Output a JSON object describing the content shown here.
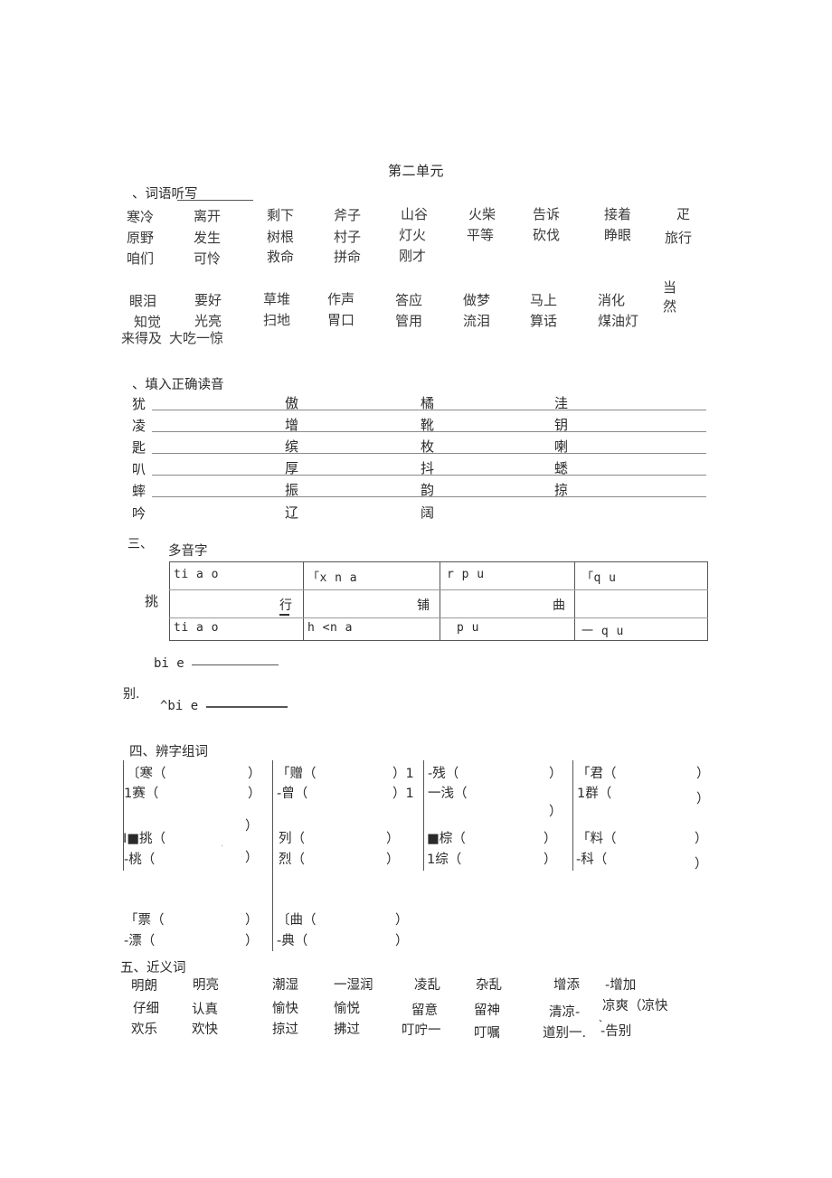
{
  "document": {
    "title": "第二单元"
  },
  "section1": {
    "heading": "、词语听写",
    "rows": [
      [
        "寒冷",
        "离开",
        "剩下",
        "斧子",
        "山谷",
        "火柴",
        "告诉",
        "接着",
        "疋"
      ],
      [
        "原野",
        "发生",
        "树根",
        "村子",
        "灯火",
        "平等",
        "砍伐",
        "睁眼",
        "旅行"
      ],
      [
        "咱们",
        "可怜",
        "救命",
        "拼命",
        "刚才",
        "",
        "",
        "",
        ""
      ],
      [
        "眼泪",
        "要好",
        "草堆",
        "作声",
        "答应",
        "做梦",
        "马上",
        "消化",
        "当然"
      ],
      [
        "知觉",
        "光亮",
        "扫地",
        "胃口",
        "管用",
        "流泪",
        "算话",
        "煤油灯",
        ""
      ],
      [
        "来得及",
        "大吃一惊",
        "",
        "",
        "",
        "",
        "",
        "",
        ""
      ]
    ]
  },
  "section2": {
    "heading": "、填入正确读音",
    "rows": [
      {
        "lead": "犹",
        "chars": [
          "傲",
          "橘",
          "洼"
        ]
      },
      {
        "lead": "凌",
        "chars": [
          "增",
          "靴",
          "钥"
        ]
      },
      {
        "lead": "匙",
        "chars": [
          "缤",
          "枚",
          "喇"
        ]
      },
      {
        "lead": "叭",
        "chars": [
          "厚",
          "抖",
          "蟋"
        ]
      },
      {
        "lead": "蟀",
        "chars": [
          "振",
          "韵",
          "掠"
        ]
      },
      {
        "lead": "吟",
        "chars": [
          "辽",
          "阔",
          ""
        ]
      }
    ]
  },
  "section3": {
    "number": "三、",
    "heading": "多音字",
    "left_char": "挑",
    "columns": [
      {
        "top_pinyin": "ti a o",
        "char": "行",
        "bottom_pinyin": "ti a o"
      },
      {
        "top_pinyin": "「x n a",
        "char": "铺",
        "bottom_pinyin": "h <n a"
      },
      {
        "top_pinyin": "r p u",
        "char": "曲",
        "bottom_pinyin": "p u"
      },
      {
        "top_pinyin": "「q u",
        "char": "",
        "bottom_pinyin": "一 q u"
      }
    ],
    "bie_block": {
      "line1": "bi e",
      "middle": "别.",
      "line2": "^bi e"
    }
  },
  "section4": {
    "heading": "四、辨字组词",
    "groups": [
      {
        "prefix1": "〔",
        "char1": "寒",
        "prefix2": "1",
        "char2": "赛",
        "suffix1": "",
        "suffix2": ""
      },
      {
        "prefix1": "「",
        "char1": "赠",
        "prefix2": "-",
        "char2": "曾",
        "suffix1": "1",
        "suffix2": "1"
      },
      {
        "prefix1": "-",
        "char1": "残",
        "prefix2": "一",
        "char2": "浅",
        "suffix1": "",
        "suffix2": ""
      },
      {
        "prefix1": "「",
        "char1": "君",
        "prefix2": "1",
        "char2": "群",
        "suffix1": "",
        "suffix2": ""
      },
      {
        "prefix1": "I■",
        "char1": "挑",
        "prefix2": "-",
        "char2": "桃",
        "suffix1": "",
        "suffix2": ""
      },
      {
        "prefix1": "",
        "char1": "列",
        "prefix2": "",
        "char2": "烈",
        "suffix1": "",
        "suffix2": ""
      },
      {
        "prefix1": "■",
        "char1": "棕",
        "prefix2": "1",
        "char2": "综",
        "suffix1": "",
        "suffix2": ""
      },
      {
        "prefix1": "「",
        "char1": "料",
        "prefix2": "-",
        "char2": "科",
        "suffix1": "",
        "suffix2": ""
      },
      {
        "prefix1": "「",
        "char1": "票",
        "prefix2": "-",
        "char2": "漂",
        "suffix1": "",
        "suffix2": ""
      },
      {
        "prefix1": "〔",
        "char1": "曲",
        "prefix2": "-",
        "char2": "典",
        "suffix1": "",
        "suffix2": ""
      }
    ],
    "open_paren": "（",
    "close_paren": "）"
  },
  "section5": {
    "heading": "五、近义词",
    "rows": [
      [
        "明朗",
        "明亮",
        "潮湿",
        "一湿润",
        "凌乱",
        "杂乱",
        "增添",
        "-增加"
      ],
      [
        "仔细",
        "认真",
        "愉快",
        "愉悦",
        "留意",
        "留神",
        "清凉-",
        "凉爽（凉快"
      ],
      [
        "欢乐",
        "欢快",
        "掠过",
        "拂过",
        "叮咛一",
        "叮嘱",
        "道别一.",
        "-告别"
      ]
    ],
    "stray_mark": "、"
  }
}
